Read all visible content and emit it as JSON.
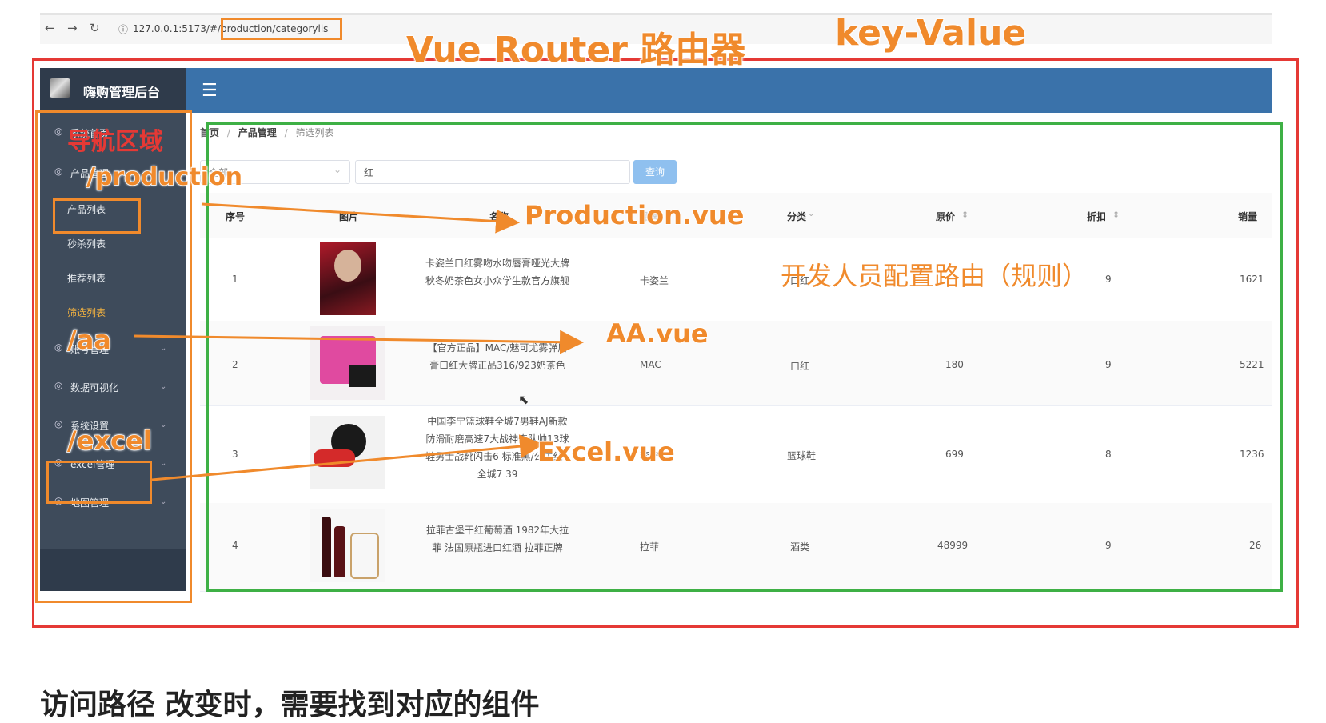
{
  "browser": {
    "back_icon": "back-arrow-icon",
    "forward_icon": "forward-arrow-icon",
    "reload_icon": "reload-icon",
    "url": "127.0.0.1:5173/#/production/categorylis"
  },
  "app": {
    "title": "嗨购管理后台",
    "hamburger": "☰"
  },
  "sidebar": {
    "items": [
      {
        "label": "系统首页"
      },
      {
        "label": "产品管理"
      },
      {
        "label": "产品列表"
      },
      {
        "label": "秒杀列表"
      },
      {
        "label": "推荐列表"
      },
      {
        "label": "筛选列表"
      },
      {
        "label": "账号管理"
      },
      {
        "label": "数据可视化"
      },
      {
        "label": "系统设置"
      },
      {
        "label": "excel管理"
      },
      {
        "label": "地图管理"
      }
    ]
  },
  "breadcrumb": {
    "home": "首页",
    "sep": "/",
    "level1": "产品管理",
    "level2": "筛选列表"
  },
  "filter": {
    "select_value": "全部",
    "input_value": "红",
    "query_label": "查询"
  },
  "table": {
    "headers": [
      "序号",
      "图片",
      "名称",
      "品牌",
      "分类",
      "原价",
      "折扣",
      "销量"
    ],
    "sort_icon": "⇕",
    "rows": [
      {
        "index": "1",
        "name": "卡姿兰口红雾吻水吻唇膏哑光大牌秋冬奶茶色女小众学生款官方旗舰",
        "brand": "卡姿兰",
        "category": "口红",
        "price": "",
        "discount": "9",
        "sales": "1621"
      },
      {
        "index": "2",
        "name": "【官方正品】MAC/魅可尤雾弹唇膏口红大牌正品316/923奶茶色",
        "brand": "MAC",
        "category": "口红",
        "price": "180",
        "discount": "9",
        "sales": "5221"
      },
      {
        "index": "3",
        "name": "中国李宁篮球鞋全城7男鞋AJ新款防滑耐磨高速7大战神奇队帅13球鞋男士战靴闪击6 标准黑/公牛红 -全城7 39",
        "brand": "李宁",
        "category": "篮球鞋",
        "price": "699",
        "discount": "8",
        "sales": "1236"
      },
      {
        "index": "4",
        "name": "拉菲古堡干红葡萄酒 1982年大拉菲 法国原瓶进口红酒 拉菲正牌",
        "brand": "拉菲",
        "category": "酒类",
        "price": "48999",
        "discount": "9",
        "sales": "26"
      }
    ]
  },
  "annotations": {
    "vue_router": "Vue Router 路由器",
    "key_value": "key-Value",
    "nav_area": "导航区域",
    "production_path": "/production",
    "production_vue": "Production.vue",
    "aa_path": "/aa",
    "aa_vue": "AA.vue",
    "excel_path": "/excel",
    "excel_vue": "Excel.vue",
    "dev_config": "开发人员配置路由（规则）",
    "bottom_text": "访问路径 改变时，需要找到对应的组件"
  },
  "colors": {
    "annotation_orange": "#f08a2c",
    "annotation_red": "#e53935",
    "annotation_green": "#3eb045",
    "topbar_blue": "#3a72aa",
    "sidebar_dark": "#3e4b5b"
  }
}
